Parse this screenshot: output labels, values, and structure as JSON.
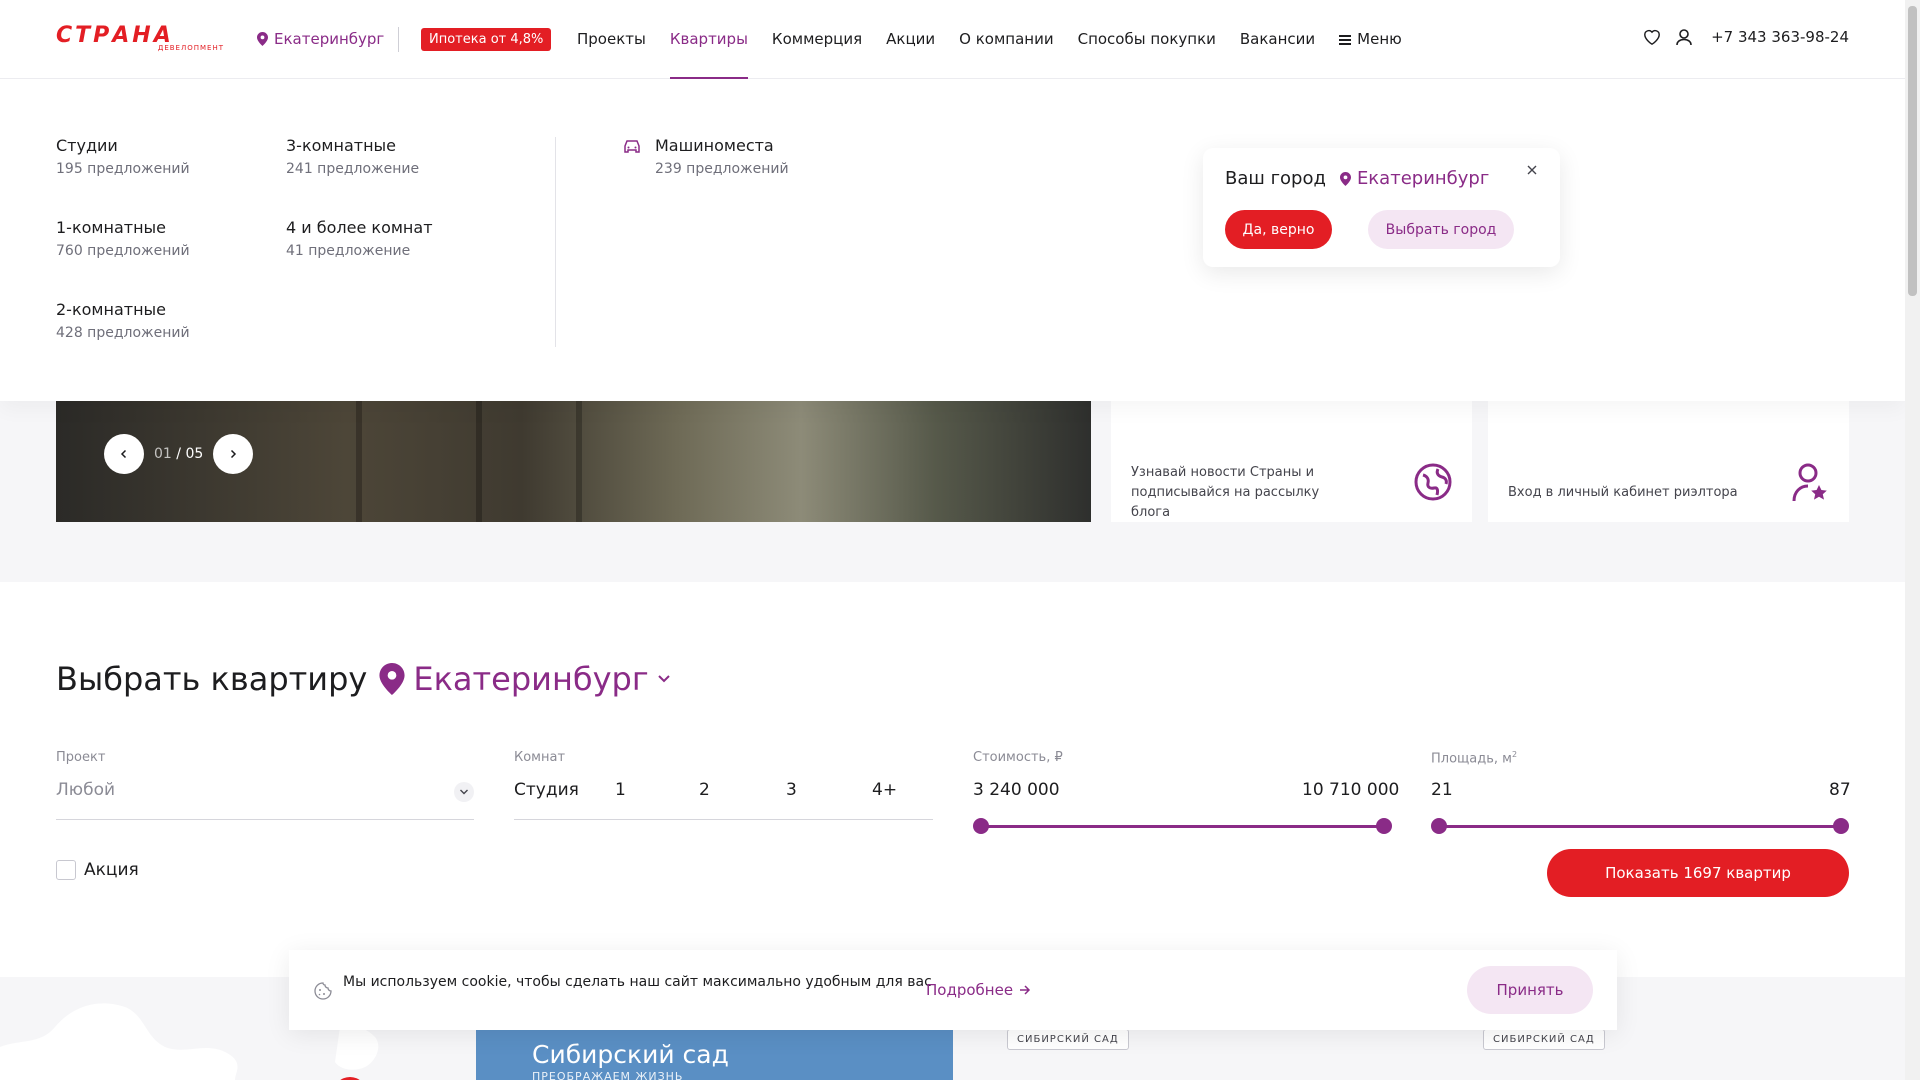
{
  "header": {
    "logo_text": "СТРАНА",
    "logo_sub": "ДЕВЕЛОПМЕНТ",
    "city": "Екатеринбург",
    "mortgage_badge": "Ипотека от 4,8%",
    "nav": [
      {
        "label": "Проекты",
        "active": false
      },
      {
        "label": "Квартиры",
        "active": true
      },
      {
        "label": "Коммерция",
        "active": false
      },
      {
        "label": "Акции",
        "active": false
      },
      {
        "label": "О компании",
        "active": false
      },
      {
        "label": "Способы покупки",
        "active": false
      },
      {
        "label": "Вакансии",
        "active": false
      }
    ],
    "menu_label": "Меню",
    "phone": "+7 343 363-98-24",
    "icons": [
      "heart-icon",
      "user-icon"
    ]
  },
  "dropdown": {
    "items": [
      {
        "title": "Студии",
        "count": "195 предложений"
      },
      {
        "title": "1-комнатные",
        "count": "760 предложений"
      },
      {
        "title": "2-комнатные",
        "count": "428 предложений"
      },
      {
        "title": "3-комнатные",
        "count": "241 предложение"
      },
      {
        "title": "4 и более комнат",
        "count": "41 предложение"
      },
      {
        "title": "Машиноместа",
        "count": "239 предложений"
      }
    ]
  },
  "city_popup": {
    "question": "Ваш город",
    "city": "Екатеринбург",
    "yes_label": "Да, верно",
    "choose_label": "Выбрать город"
  },
  "hero": {
    "slide_current": "01",
    "slide_separator": "/",
    "slide_total": "05"
  },
  "cards": {
    "blog_text": "Узнавай новости Страны и подписывайся на рассылку блога",
    "realtor_text": "Вход в личный кабинет риэлтора"
  },
  "filter": {
    "title": "Выбрать квартиру",
    "city": "Екатеринбург",
    "project_label": "Проект",
    "project_value": "Любой",
    "rooms_label": "Комнат",
    "rooms": [
      "Студия",
      "1",
      "2",
      "3",
      "4+"
    ],
    "price_label": "Стоимость, ₽",
    "price_min": "3 240 000",
    "price_max": "10 710 000",
    "area_label": "Площадь, м",
    "area_sup": "2",
    "area_min": "21",
    "area_max": "87",
    "promo_label": "Акция",
    "show_button": "Показать 1697 квартир"
  },
  "bottom": {
    "project_name": "Сибирский сад",
    "project_tag": "ПРЕОБРАЖАЕМ ЖИЗНЬ",
    "chip1": "СИБИРСКИЙ САД",
    "chip2": "СИБИРСКИЙ САД"
  },
  "cookie": {
    "text": "Мы используем cookie, чтобы сделать наш сайт максимально удобным для вас",
    "more": "Подробнее",
    "accept": "Принять"
  },
  "colors": {
    "accent": "#8a2b87",
    "brand_red": "#e31e24",
    "soft_pink": "#f4e6f3"
  }
}
